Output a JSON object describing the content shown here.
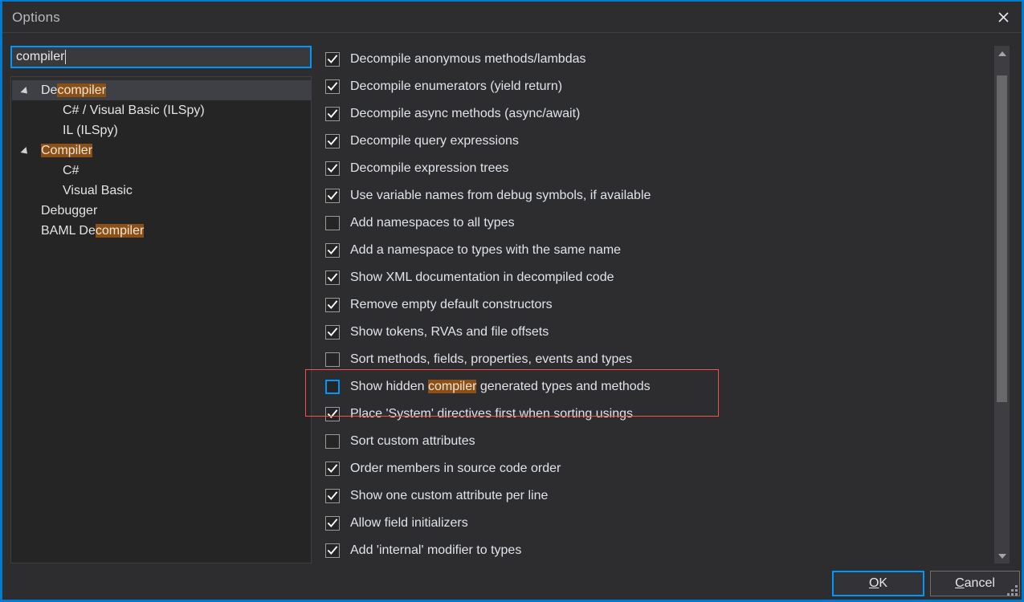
{
  "window": {
    "title": "Options",
    "close_icon": "close-icon",
    "accent_color": "#0097fb",
    "highlight_color": "#8b4f18",
    "annotation_color": "#f4514e"
  },
  "search": {
    "value": "compiler",
    "placeholder": ""
  },
  "tree": {
    "items": [
      {
        "label_pre": "De",
        "label_hl": "compiler",
        "label_post": "",
        "depth": 0,
        "expander": true,
        "selected": true
      },
      {
        "label_pre": "C# / Visual Basic (ILSpy)",
        "label_hl": "",
        "label_post": "",
        "depth": 1,
        "expander": false,
        "selected": false
      },
      {
        "label_pre": "IL (ILSpy)",
        "label_hl": "",
        "label_post": "",
        "depth": 1,
        "expander": false,
        "selected": false
      },
      {
        "label_pre": "",
        "label_hl": "Compiler",
        "label_post": "",
        "depth": 0,
        "expander": true,
        "selected": false
      },
      {
        "label_pre": "C#",
        "label_hl": "",
        "label_post": "",
        "depth": 1,
        "expander": false,
        "selected": false
      },
      {
        "label_pre": "Visual Basic",
        "label_hl": "",
        "label_post": "",
        "depth": 1,
        "expander": false,
        "selected": false
      },
      {
        "label_pre": "Debugger",
        "label_hl": "",
        "label_post": "",
        "depth": 0,
        "expander": false,
        "selected": false
      },
      {
        "label_pre": "BAML De",
        "label_hl": "compiler",
        "label_post": "",
        "depth": 0,
        "expander": false,
        "selected": false
      }
    ]
  },
  "options": {
    "items": [
      {
        "label_pre": "Decompile anonymous methods/lambdas",
        "label_hl": "",
        "label_post": "",
        "checked": true,
        "focused": false
      },
      {
        "label_pre": "Decompile enumerators (yield return)",
        "label_hl": "",
        "label_post": "",
        "checked": true,
        "focused": false
      },
      {
        "label_pre": "Decompile async methods (async/await)",
        "label_hl": "",
        "label_post": "",
        "checked": true,
        "focused": false
      },
      {
        "label_pre": "Decompile query expressions",
        "label_hl": "",
        "label_post": "",
        "checked": true,
        "focused": false
      },
      {
        "label_pre": "Decompile expression trees",
        "label_hl": "",
        "label_post": "",
        "checked": true,
        "focused": false
      },
      {
        "label_pre": "Use variable names from debug symbols, if available",
        "label_hl": "",
        "label_post": "",
        "checked": true,
        "focused": false
      },
      {
        "label_pre": "Add namespaces to all types",
        "label_hl": "",
        "label_post": "",
        "checked": false,
        "focused": false
      },
      {
        "label_pre": "Add a namespace to types with the same name",
        "label_hl": "",
        "label_post": "",
        "checked": true,
        "focused": false
      },
      {
        "label_pre": "Show XML documentation in decompiled code",
        "label_hl": "",
        "label_post": "",
        "checked": true,
        "focused": false
      },
      {
        "label_pre": "Remove empty default constructors",
        "label_hl": "",
        "label_post": "",
        "checked": true,
        "focused": false
      },
      {
        "label_pre": "Show tokens, RVAs and file offsets",
        "label_hl": "",
        "label_post": "",
        "checked": true,
        "focused": false
      },
      {
        "label_pre": "Sort methods, fields, properties, events and types",
        "label_hl": "",
        "label_post": "",
        "checked": false,
        "focused": false
      },
      {
        "label_pre": "Show hidden ",
        "label_hl": "compiler",
        "label_post": " generated types and methods",
        "checked": false,
        "focused": true
      },
      {
        "label_pre": "Place 'System' directives first when sorting usings",
        "label_hl": "",
        "label_post": "",
        "checked": true,
        "focused": false
      },
      {
        "label_pre": "Sort custom attributes",
        "label_hl": "",
        "label_post": "",
        "checked": false,
        "focused": false
      },
      {
        "label_pre": "Order members in source code order",
        "label_hl": "",
        "label_post": "",
        "checked": true,
        "focused": false
      },
      {
        "label_pre": "Show one custom attribute per line",
        "label_hl": "",
        "label_post": "",
        "checked": true,
        "focused": false
      },
      {
        "label_pre": "Allow field initializers",
        "label_hl": "",
        "label_post": "",
        "checked": true,
        "focused": false
      },
      {
        "label_pre": "Add 'internal' modifier to types",
        "label_hl": "",
        "label_post": "",
        "checked": true,
        "focused": false
      }
    ]
  },
  "scrollbar": {
    "up_icon": "chevron-up-icon",
    "down_icon": "chevron-down-icon",
    "thumb_top_pct": 3,
    "thumb_height_pct": 67
  },
  "footer": {
    "ok": {
      "accel": "O",
      "pre": "",
      "post": "K",
      "is_default": true
    },
    "cancel": {
      "accel": "C",
      "pre": "",
      "post": "ancel",
      "is_default": false
    }
  }
}
